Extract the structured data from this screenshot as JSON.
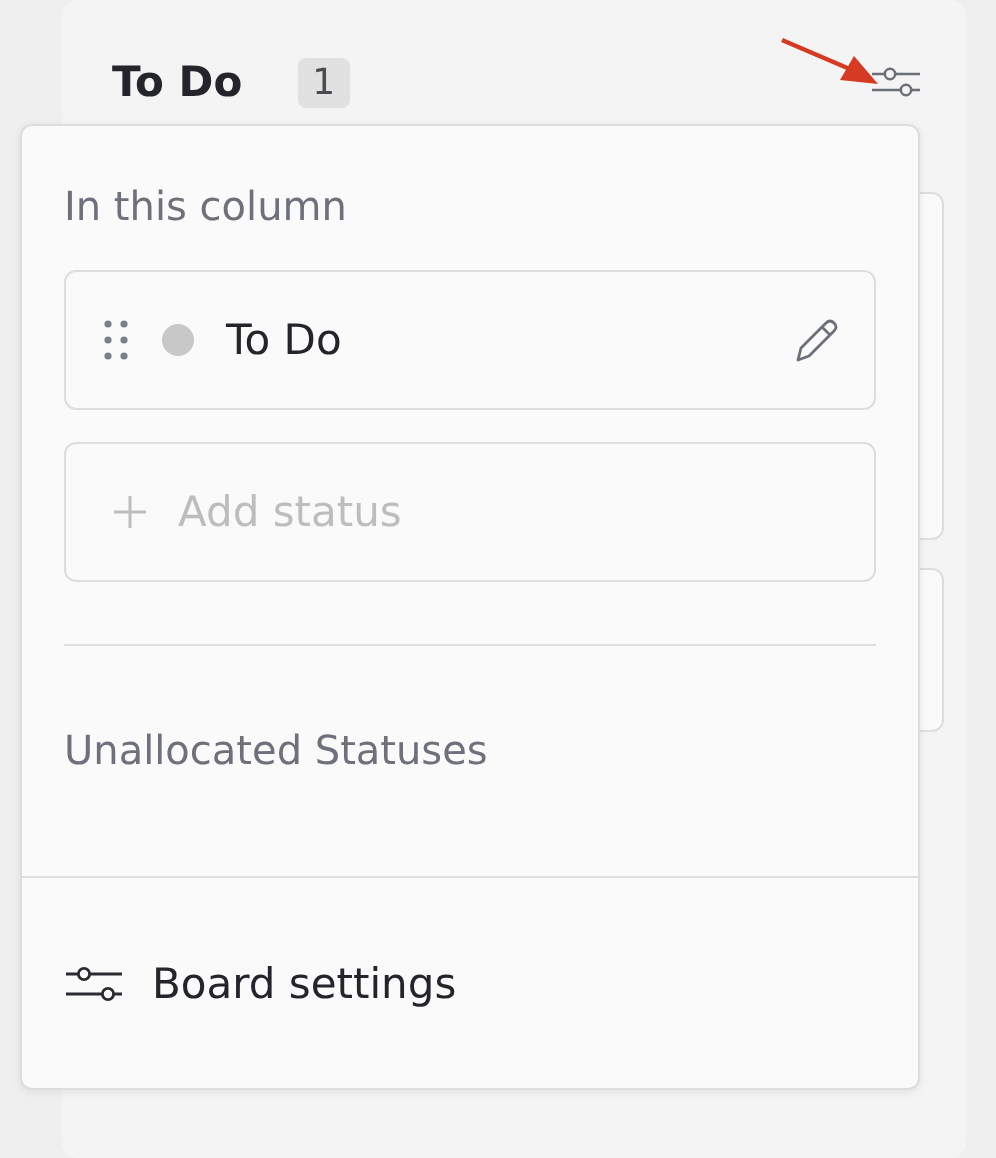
{
  "column": {
    "title": "To Do",
    "count": "1"
  },
  "menu": {
    "section_title": "In this column",
    "statuses": [
      {
        "name": "To Do",
        "color": "#c8c8c8"
      }
    ],
    "add_label": "Add status",
    "unallocated_title": "Unallocated Statuses",
    "footer_label": "Board settings"
  }
}
